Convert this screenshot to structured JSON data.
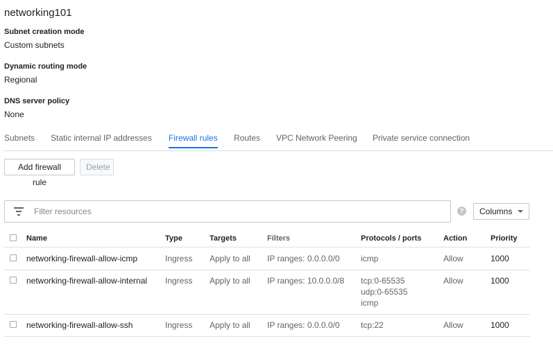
{
  "network": {
    "name": "networking101",
    "details": [
      {
        "label": "Subnet creation mode",
        "value": "Custom subnets"
      },
      {
        "label": "Dynamic routing mode",
        "value": "Regional"
      },
      {
        "label": "DNS server policy",
        "value": "None"
      }
    ]
  },
  "tabs": [
    {
      "label": "Subnets",
      "active": false
    },
    {
      "label": "Static internal IP addresses",
      "active": false
    },
    {
      "label": "Firewall rules",
      "active": true
    },
    {
      "label": "Routes",
      "active": false
    },
    {
      "label": "VPC Network Peering",
      "active": false
    },
    {
      "label": "Private service connection",
      "active": false
    }
  ],
  "toolbar": {
    "add_label": "Add firewall rule",
    "delete_label": "Delete"
  },
  "filter": {
    "placeholder": "Filter resources"
  },
  "columns_button": "Columns",
  "table": {
    "headers": [
      "Name",
      "Type",
      "Targets",
      "Filters",
      "Protocols / ports",
      "Action",
      "Priority"
    ],
    "rows": [
      {
        "name": "networking-firewall-allow-icmp",
        "type": "Ingress",
        "targets": "Apply to all",
        "filters": "IP ranges: 0.0.0.0/0",
        "protocols": [
          "icmp"
        ],
        "action": "Allow",
        "priority": "1000"
      },
      {
        "name": "networking-firewall-allow-internal",
        "type": "Ingress",
        "targets": "Apply to all",
        "filters": "IP ranges: 10.0.0.0/8",
        "protocols": [
          "tcp:0-65535",
          "udp:0-65535",
          "icmp"
        ],
        "action": "Allow",
        "priority": "1000"
      },
      {
        "name": "networking-firewall-allow-ssh",
        "type": "Ingress",
        "targets": "Apply to all",
        "filters": "IP ranges: 0.0.0.0/0",
        "protocols": [
          "tcp:22"
        ],
        "action": "Allow",
        "priority": "1000"
      }
    ]
  },
  "colors": {
    "accent": "#1a73e8",
    "text": "#202124",
    "secondary": "#5f6368",
    "divider": "#e0e0e0"
  },
  "icons": {
    "filter": "filter-list-icon",
    "help": "help-icon",
    "dropdown": "caret-down-icon"
  }
}
